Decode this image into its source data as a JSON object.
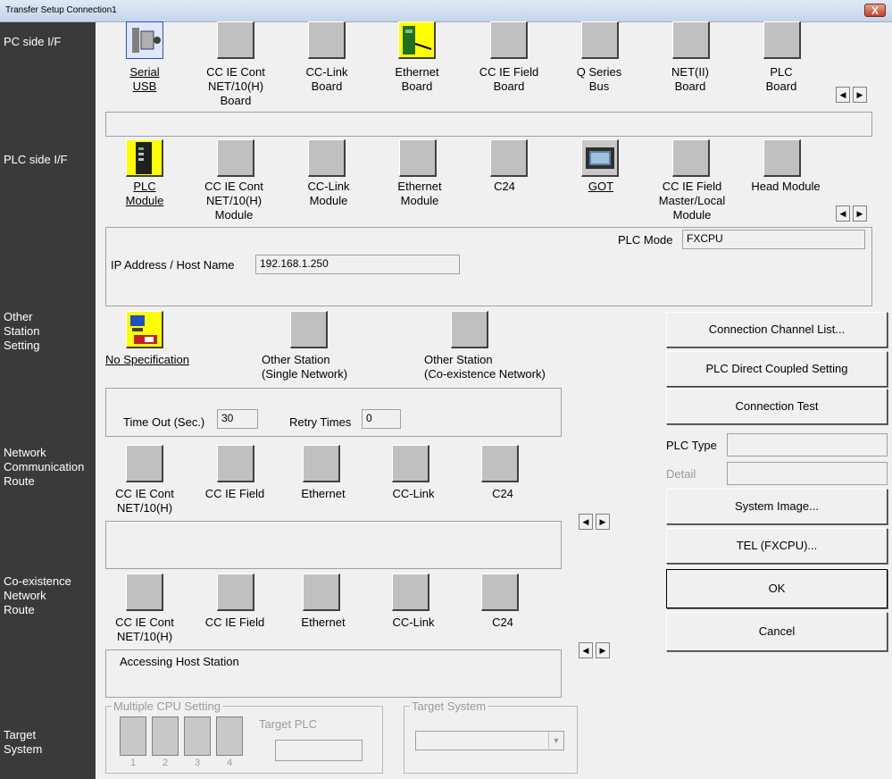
{
  "window": {
    "title": "Transfer Setup Connection1",
    "close_label": "X"
  },
  "sidebar": {
    "pc_side": "PC side I/F",
    "plc_side": "PLC side I/F",
    "other_station": "Other\nStation\nSetting",
    "network_route": "Network\nCommunication\nRoute",
    "coexist_route": "Co-existence\nNetwork\nRoute",
    "target_system": "Target\nSystem"
  },
  "pc_side_items": [
    {
      "label": "Serial\nUSB"
    },
    {
      "label": "CC IE Cont\nNET/10(H)\nBoard"
    },
    {
      "label": "CC-Link\nBoard"
    },
    {
      "label": "Ethernet\nBoard"
    },
    {
      "label": "CC IE Field\nBoard"
    },
    {
      "label": "Q Series\nBus"
    },
    {
      "label": "NET(II)\nBoard"
    },
    {
      "label": "PLC\nBoard"
    }
  ],
  "plc_side_items": [
    {
      "label": "PLC\nModule"
    },
    {
      "label": "CC IE Cont\nNET/10(H)\nModule"
    },
    {
      "label": "CC-Link\nModule"
    },
    {
      "label": "Ethernet\nModule"
    },
    {
      "label": "C24"
    },
    {
      "label": "GOT"
    },
    {
      "label": "CC IE Field\nMaster/Local\nModule"
    },
    {
      "label": "Head Module"
    }
  ],
  "plc_panel": {
    "plc_mode_label": "PLC Mode",
    "plc_mode_value": "FXCPU",
    "ip_label": "IP Address / Host Name",
    "ip_value": "192.168.1.250"
  },
  "other_station_items": [
    {
      "label": "No Specification"
    },
    {
      "label": "Other Station\n(Single Network)"
    },
    {
      "label": "Other Station\n(Co-existence Network)"
    }
  ],
  "timeout": {
    "timeout_label": "Time Out (Sec.)",
    "timeout_value": "30",
    "retry_label": "Retry Times",
    "retry_value": "0"
  },
  "network_items": [
    "CC IE Cont\nNET/10(H)",
    "CC IE Field",
    "Ethernet",
    "CC-Link",
    "C24"
  ],
  "coexist_items": [
    "CC IE Cont\nNET/10(H)",
    "CC IE Field",
    "Ethernet",
    "CC-Link",
    "C24"
  ],
  "coexist_panel": {
    "text": "Accessing Host Station"
  },
  "right_buttons": {
    "connection_channel_list": "Connection Channel List...",
    "plc_direct": "PLC Direct Coupled Setting",
    "connection_test": "Connection Test",
    "plc_type_label": "PLC Type",
    "detail_label": "Detail",
    "system_image": "System Image...",
    "tel": "TEL (FXCPU)...",
    "ok": "OK",
    "cancel": "Cancel"
  },
  "target": {
    "multi_cpu_label": "Multiple CPU Setting",
    "cpu_numbers": [
      "1",
      "2",
      "3",
      "4"
    ],
    "target_plc_label": "Target PLC",
    "target_system_label": "Target System"
  },
  "arrows": {
    "left": "◀",
    "right": "▶"
  }
}
